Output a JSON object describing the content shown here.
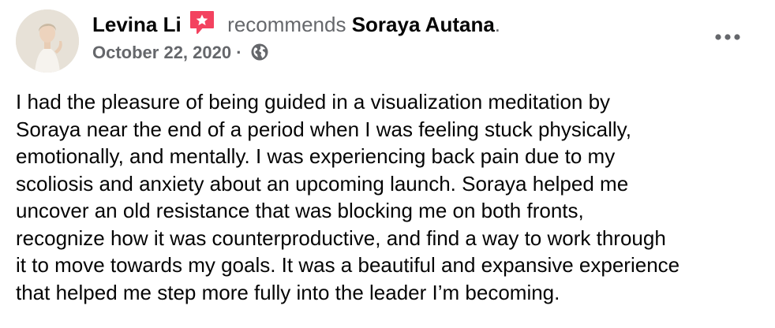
{
  "post": {
    "author": "Levina Li",
    "verb": "recommends",
    "page": "Soraya Autana",
    "period": ".",
    "date": "October 22, 2020",
    "separator": "·",
    "privacy_icon": "globe-icon",
    "recommend_icon": "recommend-badge-icon",
    "more_icon": "more-dots-icon",
    "body_lines": [
      "I had the pleasure of being guided in a visualization meditation by",
      "Soraya near the end of a period when I was feeling stuck physically,",
      "emotionally, and mentally. I was experiencing back pain due to my",
      "scoliosis and anxiety about an upcoming launch. Soraya helped me",
      "uncover an old resistance that was blocking me on both fronts,",
      "recognize how it was counterproductive, and find a way to work through",
      "it to move towards my goals. It was a beautiful and expansive experience",
      "that helped me step more fully into the leader I’m becoming."
    ]
  },
  "colors": {
    "text_primary": "#050505",
    "text_secondary": "#65676b",
    "recommend_accent": "#f3425f"
  }
}
